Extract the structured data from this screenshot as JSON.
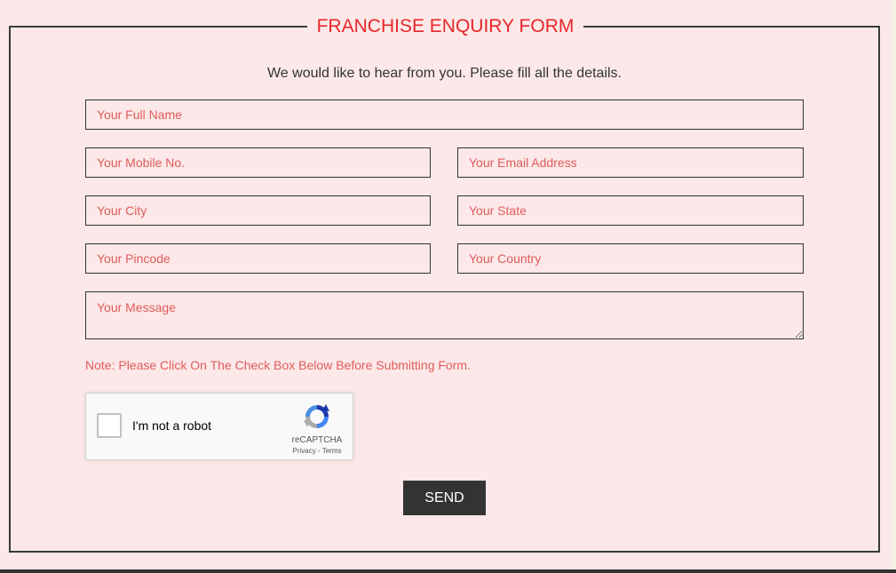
{
  "form": {
    "title": "FRANCHISE ENQUIRY FORM",
    "subtitle": "We would like to hear from you. Please fill all the details.",
    "fields": {
      "full_name": {
        "placeholder": "Your Full Name",
        "value": ""
      },
      "mobile": {
        "placeholder": "Your Mobile No.",
        "value": ""
      },
      "email": {
        "placeholder": "Your Email Address",
        "value": ""
      },
      "city": {
        "placeholder": "Your City",
        "value": ""
      },
      "state": {
        "placeholder": "Your State",
        "value": ""
      },
      "pincode": {
        "placeholder": "Your Pincode",
        "value": ""
      },
      "country": {
        "placeholder": "Your Country",
        "value": ""
      },
      "message": {
        "placeholder": "Your Message",
        "value": ""
      }
    },
    "note": "Note: Please Click On The Check Box Below Before Submitting Form.",
    "captcha": {
      "label": "I'm not a robot",
      "brand": "reCAPTCHA",
      "privacy": "Privacy",
      "separator": " - ",
      "terms": "Terms",
      "checked": false,
      "icon": "recaptcha-logo-icon"
    },
    "submit_label": "SEND"
  },
  "colors": {
    "background": "#fce8e8",
    "accent": "#e8262a",
    "placeholder": "#e05c5c",
    "border": "#333333",
    "button": "#333333"
  }
}
